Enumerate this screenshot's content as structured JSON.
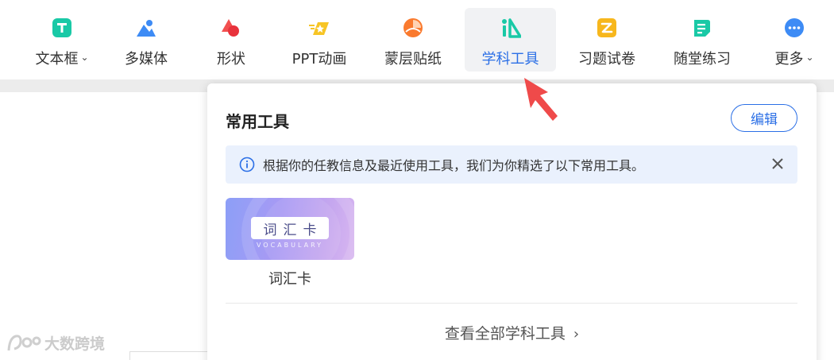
{
  "toolbar": {
    "items": [
      {
        "label": "文本框",
        "icon": "text-box-icon",
        "has_dropdown": true
      },
      {
        "label": "多媒体",
        "icon": "multimedia-icon"
      },
      {
        "label": "形状",
        "icon": "shapes-icon"
      },
      {
        "label": "PPT动画",
        "icon": "ppt-animation-icon"
      },
      {
        "label": "蒙层贴纸",
        "icon": "mask-sticker-icon"
      },
      {
        "label": "学科工具",
        "icon": "subject-tools-icon",
        "active": true
      },
      {
        "label": "习题试卷",
        "icon": "exercise-paper-icon"
      },
      {
        "label": "随堂练习",
        "icon": "class-practice-icon"
      },
      {
        "label": "更多",
        "icon": "more-icon",
        "has_dropdown": true
      }
    ],
    "active_color": "#2b6fe6"
  },
  "popover": {
    "title": "常用工具",
    "edit_label": "编辑",
    "notice": {
      "text": "根据你的任教信息及最近使用工具，我们为你精选了以下常用工具。",
      "icon": "info-icon",
      "close_icon": "close-icon"
    },
    "tools": [
      {
        "name": "词汇卡",
        "thumb_title": "词汇卡",
        "thumb_subtitle": "VOCABULARY"
      }
    ],
    "view_all_label": "查看全部学科工具",
    "view_all_icon": "chevron-right-icon"
  },
  "watermark": {
    "text": "大数跨境"
  },
  "colors": {
    "accent": "#2b6fe6",
    "notice_bg": "#eaf1fd",
    "arrow": "#ef4a4a"
  }
}
